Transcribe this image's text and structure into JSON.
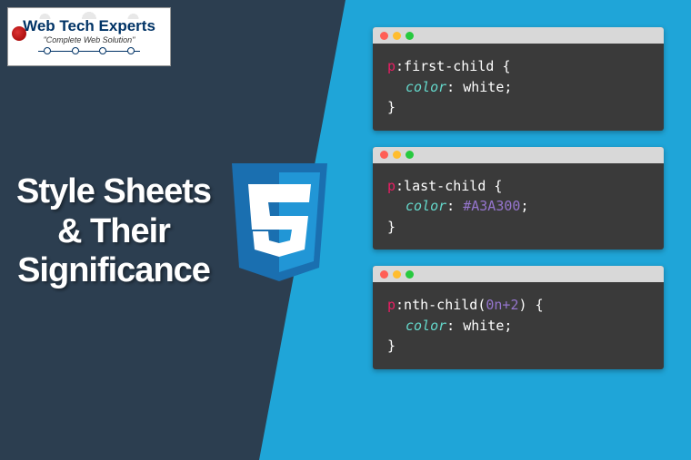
{
  "logo": {
    "title": "Web Tech Experts",
    "subtitle": "\"Complete Web Solution\""
  },
  "headline": {
    "line1": "Style Sheets",
    "line2": "& Their",
    "line3": "Significance"
  },
  "css3_badge": "3",
  "code_samples": [
    {
      "selector": "p",
      "pseudo": ":first-child",
      "property": "color",
      "value": "white",
      "value_class": "val-white"
    },
    {
      "selector": "p",
      "pseudo": ":last-child",
      "property": "color",
      "value": "#A3A300",
      "value_class": "val-hex"
    },
    {
      "selector": "p",
      "pseudo_prefix": ":nth-child(",
      "pseudo_expr": "0n+2",
      "pseudo_suffix": ")",
      "property": "color",
      "value": "white",
      "value_class": "val-white"
    }
  ]
}
